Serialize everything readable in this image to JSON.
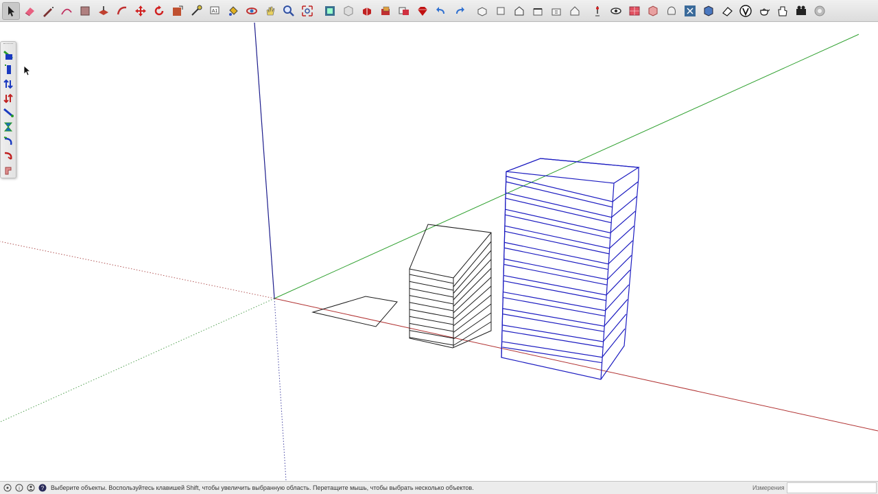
{
  "toolbar": {
    "tools": [
      {
        "name": "select-tool",
        "icon": "arrow-icon",
        "active": true
      },
      {
        "name": "eraser-tool",
        "icon": "eraser-icon"
      },
      {
        "name": "line-tool",
        "icon": "pencil-icon"
      },
      {
        "name": "arc-tool",
        "icon": "arc-icon"
      },
      {
        "name": "shapes-tool",
        "icon": "rectangle-icon"
      },
      {
        "name": "push-pull-tool",
        "icon": "push-pull-icon"
      },
      {
        "name": "follow-me-tool",
        "icon": "follow-me-icon"
      },
      {
        "name": "move-tool",
        "icon": "move-icon"
      },
      {
        "name": "rotate-tool",
        "icon": "rotate-icon"
      },
      {
        "name": "scale-tool",
        "icon": "scale-icon"
      },
      {
        "name": "tape-measure-tool",
        "icon": "tape-measure-icon"
      },
      {
        "name": "text-tool",
        "icon": "text-icon"
      },
      {
        "name": "paint-bucket-tool",
        "icon": "paint-bucket-icon"
      },
      {
        "name": "orbit-tool",
        "icon": "orbit-icon"
      },
      {
        "name": "pan-tool",
        "icon": "hand-icon"
      },
      {
        "name": "zoom-tool",
        "icon": "zoom-icon"
      },
      {
        "name": "zoom-extents-tool",
        "icon": "zoom-extents-icon"
      },
      {
        "name": "3d-warehouse-button",
        "icon": "warehouse-icon"
      },
      {
        "name": "extension-warehouse-button",
        "icon": "extension-icon"
      },
      {
        "name": "components-button",
        "icon": "component-icon"
      },
      {
        "name": "styles-button",
        "icon": "style-icon"
      },
      {
        "name": "layers-button",
        "icon": "layers-icon"
      },
      {
        "name": "sandbox-button",
        "icon": "ruby-icon"
      },
      {
        "name": "undo-button",
        "icon": "undo-icon"
      },
      {
        "name": "redo-button",
        "icon": "redo-icon"
      },
      {
        "name": "iso-view-button",
        "icon": "iso-view-icon"
      },
      {
        "name": "top-view-button",
        "icon": "top-view-icon"
      },
      {
        "name": "front-view-button",
        "icon": "front-view-icon"
      },
      {
        "name": "right-view-button",
        "icon": "right-view-icon"
      },
      {
        "name": "back-view-button",
        "icon": "back-view-icon"
      },
      {
        "name": "left-view-button",
        "icon": "left-view-icon"
      },
      {
        "name": "position-camera-button",
        "icon": "camera-position-icon"
      },
      {
        "name": "look-around-button",
        "icon": "eye-icon"
      },
      {
        "name": "section-plane-button",
        "icon": "section-icon"
      },
      {
        "name": "solid-tools-button",
        "icon": "solid-icon"
      },
      {
        "name": "outer-shell-button",
        "icon": "shell-icon"
      },
      {
        "name": "intersect-button",
        "icon": "intersect-icon"
      },
      {
        "name": "union-button",
        "icon": "union-icon"
      },
      {
        "name": "eraser-alt-button",
        "icon": "white-eraser-icon"
      },
      {
        "name": "vray-button",
        "icon": "v-circle-icon"
      },
      {
        "name": "teapot-button",
        "icon": "teapot-icon"
      },
      {
        "name": "material-button",
        "icon": "hand-material-icon"
      },
      {
        "name": "render-button",
        "icon": "render-icon"
      },
      {
        "name": "settings-button",
        "icon": "gear-icon"
      }
    ]
  },
  "side_toolbar": {
    "tools": [
      {
        "name": "side-tool-1",
        "icon": "green-blue-icon"
      },
      {
        "name": "side-tool-2",
        "icon": "blue-panel-icon"
      },
      {
        "name": "side-tool-3",
        "icon": "arrows-up-down-icon"
      },
      {
        "name": "side-tool-4",
        "icon": "red-arrows-icon"
      },
      {
        "name": "side-tool-5",
        "icon": "diagonal-icon"
      },
      {
        "name": "side-tool-6",
        "icon": "hourglass-icon"
      },
      {
        "name": "side-tool-7",
        "icon": "curve-arrow-icon"
      },
      {
        "name": "side-tool-8",
        "icon": "red-curve-icon"
      },
      {
        "name": "side-tool-9",
        "icon": "pink-icon"
      }
    ]
  },
  "colors": {
    "axis_red": "#b03030",
    "axis_green": "#2ea02e",
    "axis_blue": "#1c1c8c",
    "selection_blue": "#1a1ac0",
    "edge_black": "#1a1a1a"
  },
  "status": {
    "text": "Выберите объекты. Воспользуйтесь клавишей Shift, чтобы увеличить выбранную область. Перетащите мышь, чтобы выбрать несколько объектов.",
    "measurements_label": "Измерения",
    "measurements_value": ""
  }
}
